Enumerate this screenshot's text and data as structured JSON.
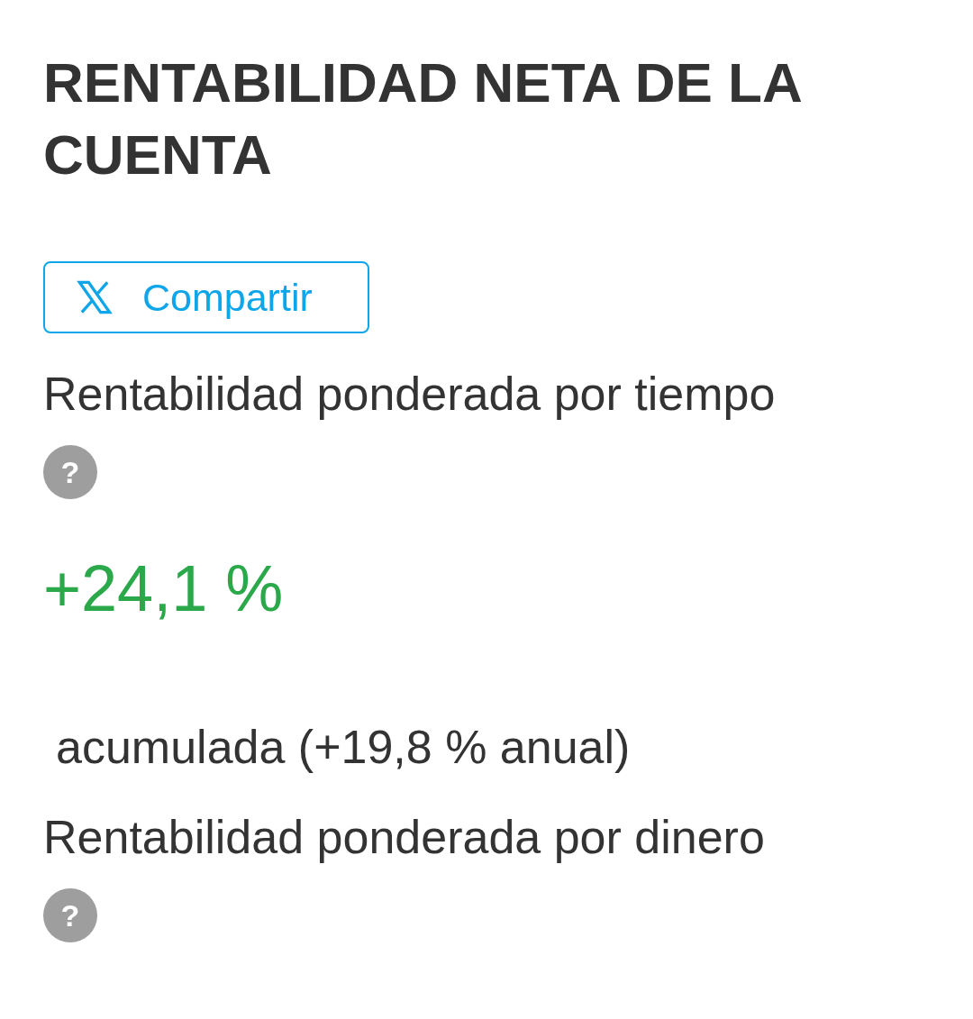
{
  "title": "RENTABILIDAD NETA DE LA CUENTA",
  "share_button": {
    "label": "Compartir"
  },
  "metrics": [
    {
      "label": "Rentabilidad ponderada por tiempo",
      "help": "?",
      "value": "+24,1 %",
      "note": "acumulada (+19,8 % anual)"
    },
    {
      "label": "Rentabilidad ponderada por dinero",
      "help": "?"
    }
  ]
}
